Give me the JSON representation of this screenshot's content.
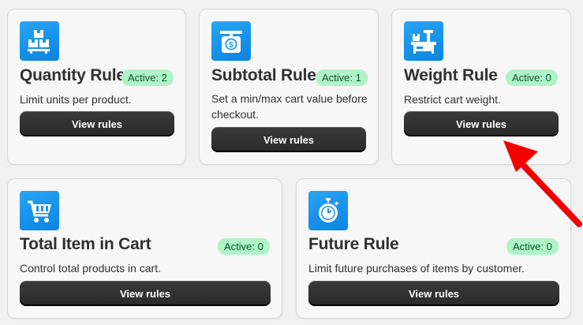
{
  "cards": [
    {
      "icon": "boxes-icon",
      "title": "Quantity Rule",
      "badge": "Active: 2",
      "description": "Limit units per product.",
      "button": "View rules"
    },
    {
      "icon": "dollar-scale-icon",
      "title": "Subtotal Rule",
      "badge": "Active: 1",
      "description": "Set a min/max cart value before checkout.",
      "button": "View rules"
    },
    {
      "icon": "weight-scale-icon",
      "title": "Weight Rule",
      "badge": "Active: 0",
      "description": "Restrict cart weight.",
      "button": "View rules"
    },
    {
      "icon": "shopping-cart-icon",
      "title": "Total Item in Cart",
      "badge": "Active: 0",
      "description": "Control total products in cart.",
      "button": "View rules"
    },
    {
      "icon": "stopwatch-icon",
      "title": "Future Rule",
      "badge": "Active: 0",
      "description": "Limit future purchases of items by customer.",
      "button": "View rules"
    }
  ],
  "colors": {
    "icon_background": "#1a96ec",
    "badge_background": "#aff4c6",
    "button_background": "#303030",
    "annotation_arrow": "#f20000"
  }
}
